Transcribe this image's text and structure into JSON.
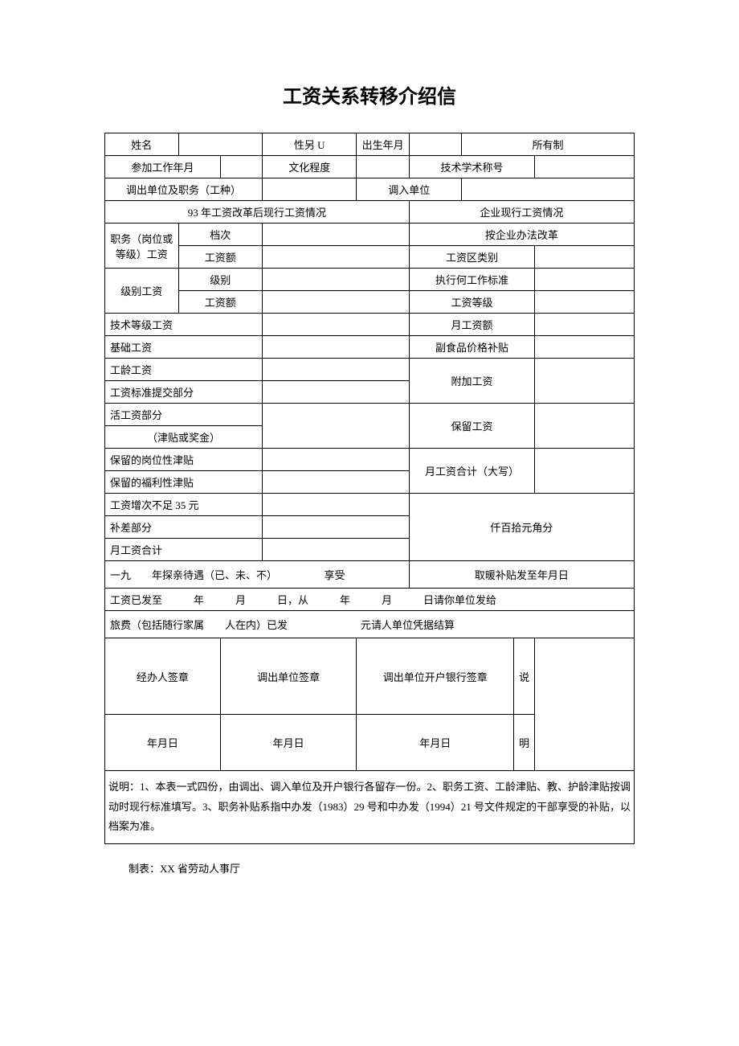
{
  "title": "工资关系转移介绍信",
  "row1": {
    "name_label": "姓名",
    "gender_label": "性另 U",
    "birth_label": "出生年月",
    "ownership_label": "所有制"
  },
  "row2": {
    "join_label": "参加工作年月",
    "edu_label": "文化程度",
    "tech_title_label": "技术学术称号"
  },
  "row3": {
    "out_unit_label": "调出单位及职务（工种）",
    "in_unit_label": "调入单位"
  },
  "section_headers": {
    "left": "93 年工资改革后现行工资情况",
    "right": "企业现行工资情况"
  },
  "left_labels": {
    "position_salary": "职务（岗位或等级）工资",
    "grade": "档次",
    "amount": "工资额",
    "level_salary": "级别工资",
    "level": "级别",
    "tech_grade": "技术等级工资",
    "base": "基础工资",
    "seniority": "工龄工资",
    "std_submit": "工资标准提交部分",
    "live_part1": "活工资部分",
    "live_part2": "（津贴或奖金）",
    "keep_post": "保留的岗位性津贴",
    "keep_welfare": "保留的福利性津贴",
    "under35": "工资增次不足 35 元",
    "diff": "补差部分",
    "month_total": "月工资合计"
  },
  "right_labels": {
    "by_enterprise": "按企业办法改革",
    "area_type": "工资区类别",
    "work_std": "执行何工作标准",
    "salary_grade": "工资等级",
    "month_amount": "月工资额",
    "food_subsidy": "副食品价格补贴",
    "extra": "附加工资",
    "retain": "保留工资",
    "month_total_cn": "月工资合计（大写）",
    "digits": "仟百拾元角分"
  },
  "bottom": {
    "visit": "一九　　年探亲待遇（已、未、不）　　　　　享受",
    "heat": "取暖补贴发至年月日",
    "paid_to": "工资已发至　　　年　　　月　　　日，从　　　年　　　月　　　日请你单位发给",
    "travel": "旅费（包括随行家属　　人在内）已发　　　　　　　元请人单位凭据结算",
    "sig1": "经办人签章",
    "sig2": "调出单位签章",
    "sig3": "调出单位开户银行签章",
    "note_char1": "说",
    "note_char2": "明",
    "date": "年月日",
    "explain": "说明：1、本表一式四份，由调出、调入单位及开户银行各留存一份。2、职务工资、工龄津贴、教、护龄津贴按调动时现行标准填写。3、职务补贴系指中办发（1983）29 号和中办发（1994）21 号文件规定的干部享受的补贴，以档案为准。"
  },
  "maker": "制表：XX 省劳动人事厅"
}
